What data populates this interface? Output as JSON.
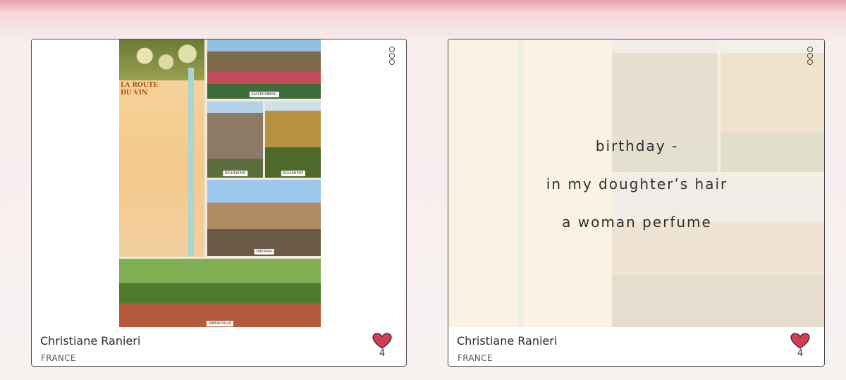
{
  "cards": [
    {
      "author": "Christiane Ranieri",
      "country": "FRANCE",
      "likes": "4",
      "postcard": {
        "title_line1": "LA ROUTE",
        "title_line2": "DU VIN",
        "labels": [
          "KAYSERSBERG",
          "RIQUEWIHR",
          "EGUISHEIM",
          "OBERNAI",
          "RIBEAUVILLE"
        ]
      }
    },
    {
      "author": "Christiane Ranieri",
      "country": "FRANCE",
      "likes": "4",
      "poem": [
        "birthday -",
        "in my doughter’s hair",
        "a woman perfume"
      ]
    }
  ],
  "icons": {
    "menu": "more-vertical-icon",
    "like": "heart-icon"
  },
  "colors": {
    "heart": "#d04055",
    "header_band": "#e8a2ac"
  }
}
